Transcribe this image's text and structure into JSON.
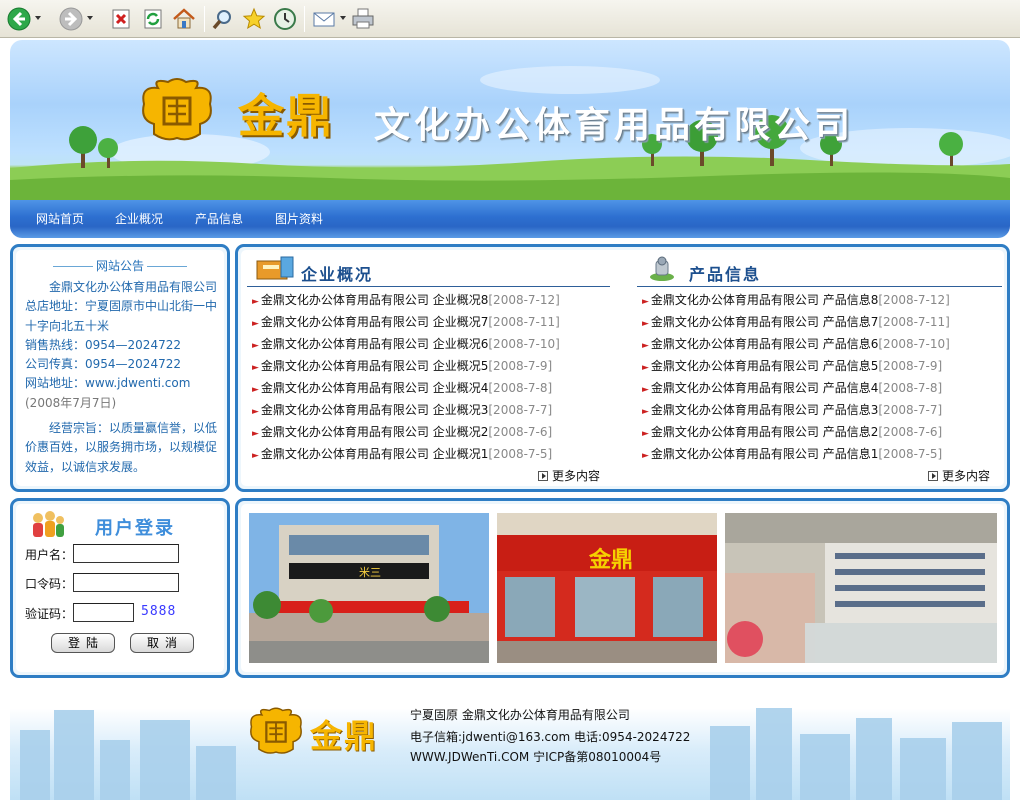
{
  "nav": {
    "items": [
      {
        "label": "网站首页"
      },
      {
        "label": "企业概况"
      },
      {
        "label": "产品信息"
      },
      {
        "label": "图片资料"
      }
    ]
  },
  "banner": {
    "brand": "金鼎",
    "company": "文化办公体育用品有限公司"
  },
  "notice": {
    "title": "网站公告",
    "lines": [
      "金鼎文化办公体育用品有限公司",
      "总店地址：宁夏固原市中山北街一中",
      "十字向北五十米",
      "销售热线：0954—2024722",
      "公司传真：0954—2024722",
      "网站地址：www.jdwenti.com",
      "(2008年7月7日)",
      "经营宗旨：以质量赢信誉，以低",
      "价惠百姓，以服务拥市场，以规模促",
      "效益，以诚信求发展。"
    ]
  },
  "company_section": {
    "title": "企业概况",
    "more": "更多内容",
    "items": [
      {
        "text": "金鼎文化办公体育用品有限公司 企业概况8",
        "date": "[2008-7-12]"
      },
      {
        "text": "金鼎文化办公体育用品有限公司 企业概况7",
        "date": "[2008-7-11]"
      },
      {
        "text": "金鼎文化办公体育用品有限公司 企业概况6",
        "date": "[2008-7-10]"
      },
      {
        "text": "金鼎文化办公体育用品有限公司 企业概况5",
        "date": "[2008-7-9]"
      },
      {
        "text": "金鼎文化办公体育用品有限公司 企业概况4",
        "date": "[2008-7-8]"
      },
      {
        "text": "金鼎文化办公体育用品有限公司 企业概况3",
        "date": "[2008-7-7]"
      },
      {
        "text": "金鼎文化办公体育用品有限公司 企业概况2",
        "date": "[2008-7-6]"
      },
      {
        "text": "金鼎文化办公体育用品有限公司 企业概况1",
        "date": "[2008-7-5]"
      }
    ]
  },
  "product_section": {
    "title": "产品信息",
    "more": "更多内容",
    "items": [
      {
        "text": "金鼎文化办公体育用品有限公司 产品信息8",
        "date": "[2008-7-12]"
      },
      {
        "text": "金鼎文化办公体育用品有限公司 产品信息7",
        "date": "[2008-7-11]"
      },
      {
        "text": "金鼎文化办公体育用品有限公司 产品信息6",
        "date": "[2008-7-10]"
      },
      {
        "text": "金鼎文化办公体育用品有限公司 产品信息5",
        "date": "[2008-7-9]"
      },
      {
        "text": "金鼎文化办公体育用品有限公司 产品信息4",
        "date": "[2008-7-8]"
      },
      {
        "text": "金鼎文化办公体育用品有限公司 产品信息3",
        "date": "[2008-7-7]"
      },
      {
        "text": "金鼎文化办公体育用品有限公司 产品信息2",
        "date": "[2008-7-6]"
      },
      {
        "text": "金鼎文化办公体育用品有限公司 产品信息1",
        "date": "[2008-7-5]"
      }
    ]
  },
  "login": {
    "title": "用户登录",
    "username_label": "用户名：",
    "password_label": "口令码：",
    "captcha_label": "验证码：",
    "captcha_value": "5888",
    "login_button": "登陆",
    "cancel_button": "取消"
  },
  "photos": [
    {
      "sign": "米三"
    },
    {
      "sign": "金鼎"
    },
    {
      "sign": ""
    }
  ],
  "footer": {
    "brand": "金鼎",
    "line1": "宁夏固原 金鼎文化办公体育用品有限公司",
    "line2": "电子信箱:jdwenti@163.com 电话:0954-2024722",
    "line3": "WWW.JDWenTi.COM 宁ICP备第08010004号"
  },
  "toolbar": {
    "icons": [
      "back-icon",
      "forward-icon",
      "stop-icon",
      "refresh-icon",
      "home-icon",
      "search-icon",
      "favorites-icon",
      "history-icon",
      "mail-icon",
      "print-icon"
    ]
  },
  "colors": {
    "accent": "#2e7dc4",
    "nav": "#2d6fd0",
    "gold": "#f6b500",
    "notice_text": "#2269ad"
  }
}
